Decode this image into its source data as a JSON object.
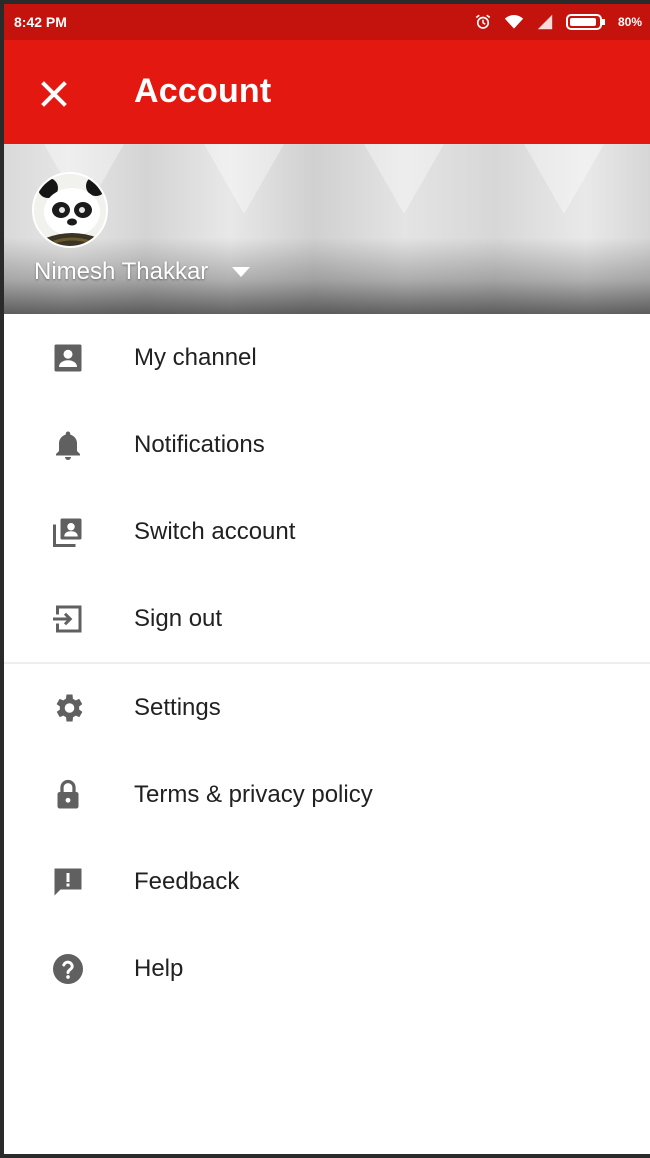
{
  "status_bar": {
    "time": "8:42 PM",
    "battery": "80%"
  },
  "app_bar": {
    "title": "Account",
    "close_icon": "close-icon"
  },
  "account": {
    "name": "Nimesh Thakkar",
    "avatar": "panda-avatar"
  },
  "menu": {
    "group1": [
      {
        "label": "My channel",
        "icon": "account-box-icon"
      },
      {
        "label": "Notifications",
        "icon": "bell-icon"
      },
      {
        "label": "Switch account",
        "icon": "switch-account-icon"
      },
      {
        "label": "Sign out",
        "icon": "sign-out-icon"
      }
    ],
    "group2": [
      {
        "label": "Settings",
        "icon": "gear-icon"
      },
      {
        "label": "Terms & privacy policy",
        "icon": "lock-icon"
      },
      {
        "label": "Feedback",
        "icon": "feedback-icon"
      },
      {
        "label": "Help",
        "icon": "help-icon"
      }
    ]
  },
  "colors": {
    "status_bar": "#c4120d",
    "app_bar": "#e31810",
    "icon": "#606060",
    "text": "#212121"
  }
}
